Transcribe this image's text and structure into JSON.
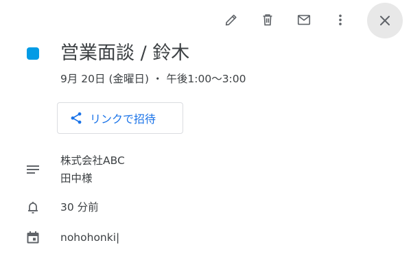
{
  "toolbar": {
    "edit_icon": "pencil-icon",
    "delete_icon": "trash-icon",
    "email_icon": "mail-icon",
    "more_icon": "more-vert-icon",
    "close_icon": "close-icon"
  },
  "event": {
    "color": "#039be5",
    "title": "営業面談 / 鈴木",
    "datetime": "9月 20日 (金曜日)  ・  午後1:00～3:00",
    "invite_label": "リンクで招待",
    "description_lines": [
      "株式会社ABC",
      "田中様"
    ],
    "reminder": "30 分前",
    "calendar": "nohohonki|"
  },
  "colors": {
    "accent": "#1a73e8",
    "icon": "#5f6368",
    "text": "#3c4043"
  }
}
